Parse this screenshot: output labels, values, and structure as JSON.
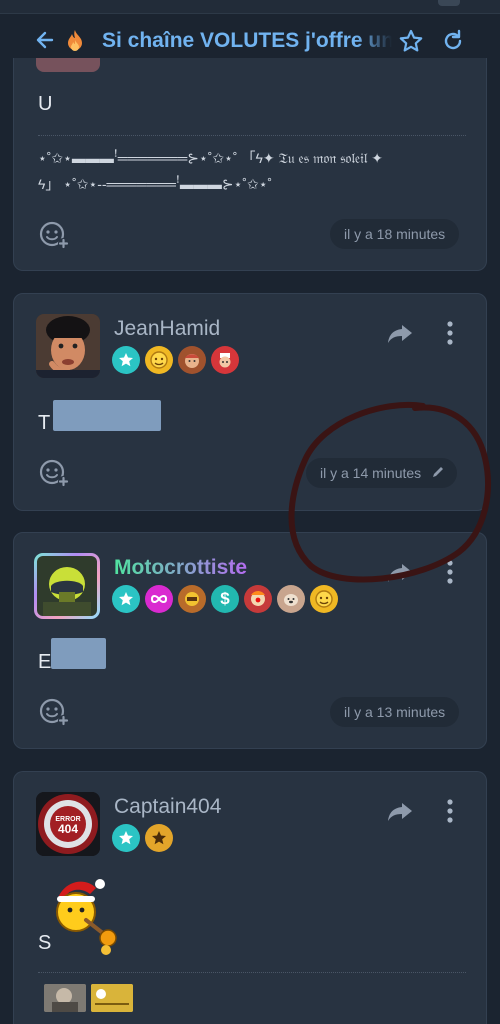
{
  "header": {
    "title": "Si chaîne VOLUTES j'offre un"
  },
  "messages": [
    {
      "username": "",
      "text": "U",
      "signature": {
        "line1": "⋆˚✩⋆▬▬▬ꜝ═══════⊱⋆˚✩⋆˚ 「ϟ✦ 𝔗𝔲 𝔢𝔰 𝔪𝔬𝔫 𝔰𝔬𝔩𝔢𝔦𝔩 ✦",
        "line2": "ϟ」 ⋆˚✩⋆--═══════ꜝ▬▬▬⊱⋆˚✩⋆˚"
      },
      "time": "il y a 18 minutes"
    },
    {
      "username": "JeanHamid",
      "text": "T",
      "time": "il y a 14 minutes",
      "edited": true,
      "badges": [
        "star-badge",
        "gold-face-badge",
        "brown-face-badge",
        "red-face-badge"
      ]
    },
    {
      "username": "Motocrottiste",
      "text": "E",
      "time": "il y a 13 minutes",
      "badges": [
        "star-badge",
        "infinity-badge",
        "gold-face-badge",
        "dollar-badge",
        "clown-badge",
        "dog-badge",
        "yellow-face-badge"
      ]
    },
    {
      "username": "Captain404",
      "text": "S",
      "avatar_text": "ERROR 404",
      "badges": [
        "star-badge",
        "gold-star-badge"
      ]
    }
  ],
  "colors": {
    "background": "#1b2430",
    "card": "#283341",
    "accent": "#71b3f0",
    "username_gradient": [
      "#50e3a0",
      "#b46cf0"
    ],
    "annotation": "#3a1414"
  }
}
